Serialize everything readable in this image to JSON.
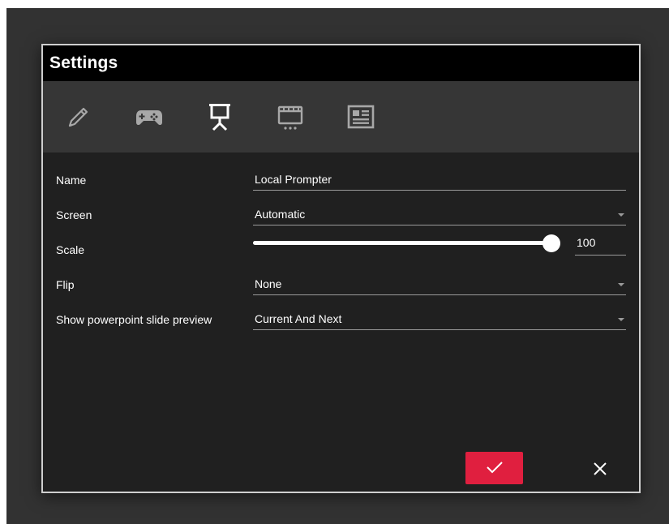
{
  "dialog": {
    "title": "Settings"
  },
  "tabs": [
    {
      "icon": "pencil-icon",
      "active": false
    },
    {
      "icon": "gamepad-icon",
      "active": false
    },
    {
      "icon": "presentation-icon",
      "active": true
    },
    {
      "icon": "clapperboard-icon",
      "active": false
    },
    {
      "icon": "news-icon",
      "active": false
    }
  ],
  "form": {
    "name": {
      "label": "Name",
      "value": "Local Prompter"
    },
    "screen": {
      "label": "Screen",
      "value": "Automatic"
    },
    "scale": {
      "label": "Scale",
      "value": "100",
      "slider_fraction": 0.995
    },
    "flip": {
      "label": "Flip",
      "value": "None"
    },
    "slide_preview": {
      "label": "Show powerpoint slide preview",
      "value": "Current And Next"
    }
  },
  "buttons": {
    "ok_icon": "check-icon",
    "close_icon": "close-icon"
  },
  "colors": {
    "accent": "#e01f3f",
    "tab_active": "#ffffff",
    "tab_inactive": "#a8a8a8"
  }
}
